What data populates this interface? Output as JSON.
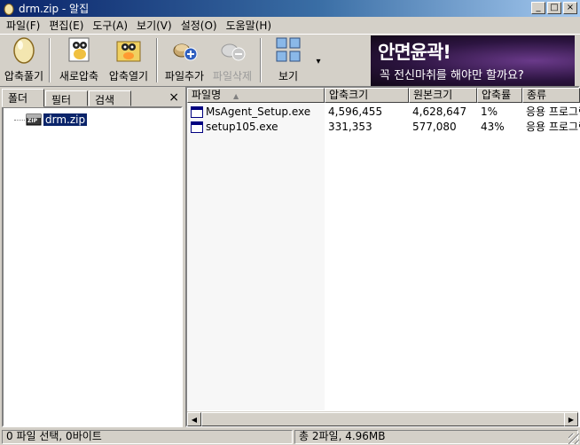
{
  "window": {
    "title": "drm.zip - 알집"
  },
  "window_controls": {
    "minimize": "_",
    "maximize": "□",
    "close": "×"
  },
  "menu": [
    "파일(F)",
    "편집(E)",
    "도구(A)",
    "보기(V)",
    "설정(O)",
    "도움말(H)"
  ],
  "toolbar": {
    "extract": "압축풀기",
    "new_archive": "새로압축",
    "open_archive": "압축열기",
    "add_file": "파일추가",
    "delete_file": "파일삭제",
    "view": "보기",
    "dropdown": "▾"
  },
  "ad": {
    "headline": "안면윤곽!",
    "subline": "꼭 전신마취를 해야만 할까요?"
  },
  "left_panel": {
    "tabs": [
      "폴더",
      "필터",
      "검색"
    ],
    "close": "×",
    "tree": {
      "label": "drm.zip",
      "icon_text": "ZIP"
    }
  },
  "file_list": {
    "columns": [
      "파일명",
      "압축크기",
      "원본크기",
      "압축률",
      "종류"
    ],
    "sort_indicator": "▲",
    "rows": [
      {
        "name": "MsAgent_Setup.exe",
        "compressed": "4,596,455",
        "original": "4,628,647",
        "ratio": "1%",
        "type": "응용 프로그램"
      },
      {
        "name": "setup105.exe",
        "compressed": "331,353",
        "original": "577,080",
        "ratio": "43%",
        "type": "응용 프로그램"
      }
    ]
  },
  "scrollbar": {
    "left": "◀",
    "right": "▶"
  },
  "status": {
    "left": "0 파일 선택, 0바이트",
    "right": "총 2파일, 4.96MB"
  },
  "colors": {
    "titlebar_start": "#0a246a",
    "titlebar_end": "#a6caf0",
    "selection": "#0a246a",
    "chrome": "#d4d0c8"
  }
}
